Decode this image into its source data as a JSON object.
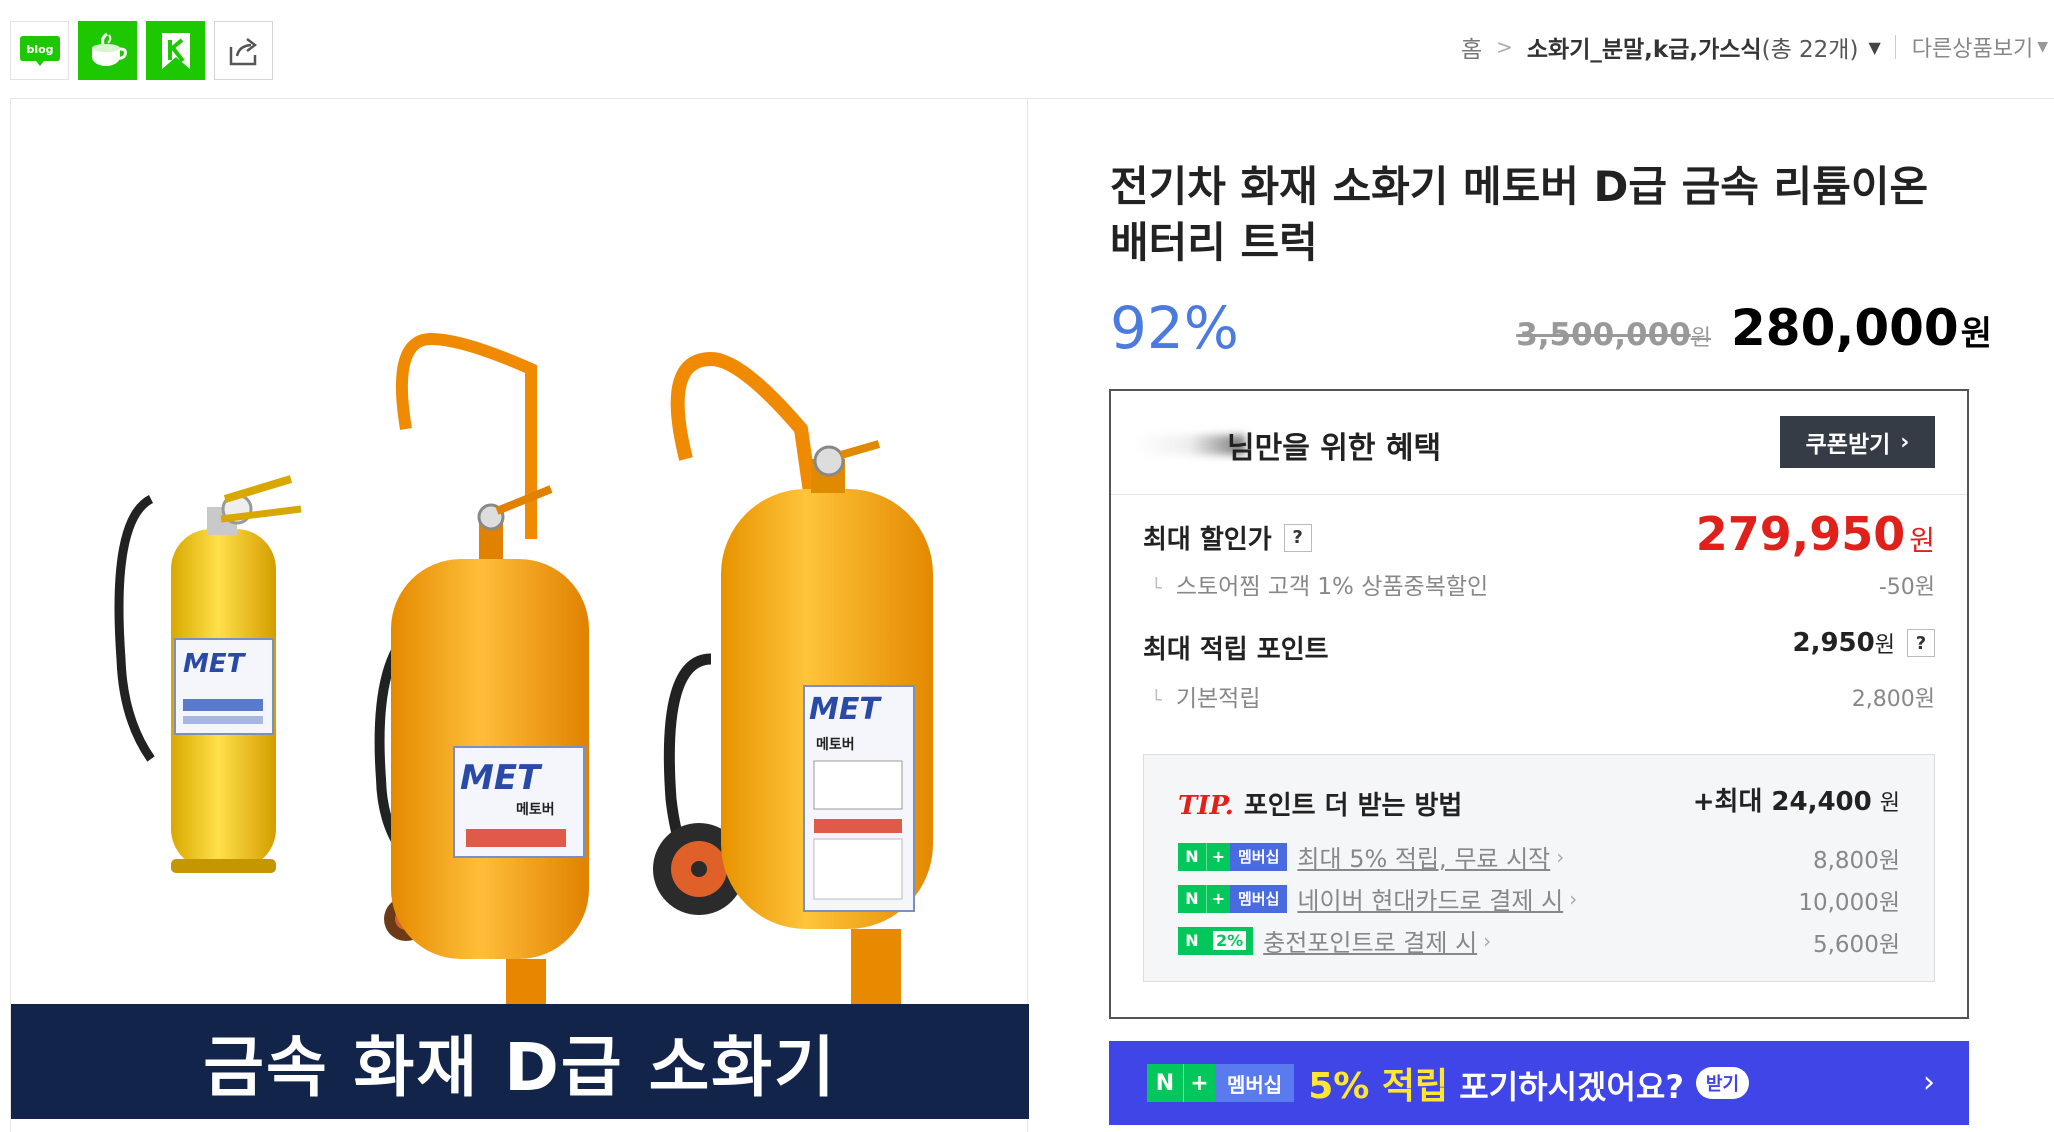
{
  "share": {
    "blog_label": "blog"
  },
  "breadcrumb": {
    "home": "홈",
    "separator": ">",
    "category": "소화기_분말,k급,가스식",
    "count": "(총 22개)",
    "other_products": "다른상품보기"
  },
  "product": {
    "title": "전기차 화재 소화기 메토버 D급 금속 리튬이온 배터리 트럭",
    "banner_text": "금속 화재 D급 소화기",
    "illustration_labels": {
      "small": "MET",
      "medium": "MET",
      "large": "MET",
      "brand": "메토버"
    }
  },
  "price": {
    "discount_rate": "92%",
    "original": "3,500,000",
    "original_unit": "원",
    "sale": "280,000",
    "sale_unit": "원"
  },
  "benefits": {
    "title": "님만을 위한 혜택",
    "coupon_button": "쿠폰받기",
    "max_discount": {
      "label": "최대 할인가",
      "help": "?",
      "value": "279,950",
      "unit": "원",
      "detail_label": "스토어찜 고객 1% 상품중복할인",
      "detail_value": "-50원"
    },
    "max_points": {
      "label": "최대 적립 포인트",
      "value": "2,950",
      "unit": "원",
      "help": "?",
      "detail_label": "기본적립",
      "detail_value": "2,800원"
    },
    "tip": {
      "tip_label": "TIP.",
      "title": "포인트 더 받는 방법",
      "max_label": "+최대 24,400",
      "max_unit": "원",
      "rows": [
        {
          "badge": "멤버십",
          "text": "최대 5% 적립, 무료 시작",
          "value": "8,800원"
        },
        {
          "badge": "멤버십",
          "text": "네이버 현대카드로 결제 시",
          "value": "10,000원"
        },
        {
          "badge": "2%",
          "text": "충전포인트로 결제 시",
          "value": "5,600원"
        }
      ]
    }
  },
  "membership_banner": {
    "badge": "멤버십",
    "highlight": "5% 적립",
    "text": "포기하시겠어요?",
    "pill": "받기"
  },
  "colors": {
    "naver_green": "#03c75a",
    "discount_blue": "#4c7be0",
    "sale_red": "#e0201b",
    "banner_navy": "#12244a",
    "membership_blue": "#3f45e6"
  }
}
